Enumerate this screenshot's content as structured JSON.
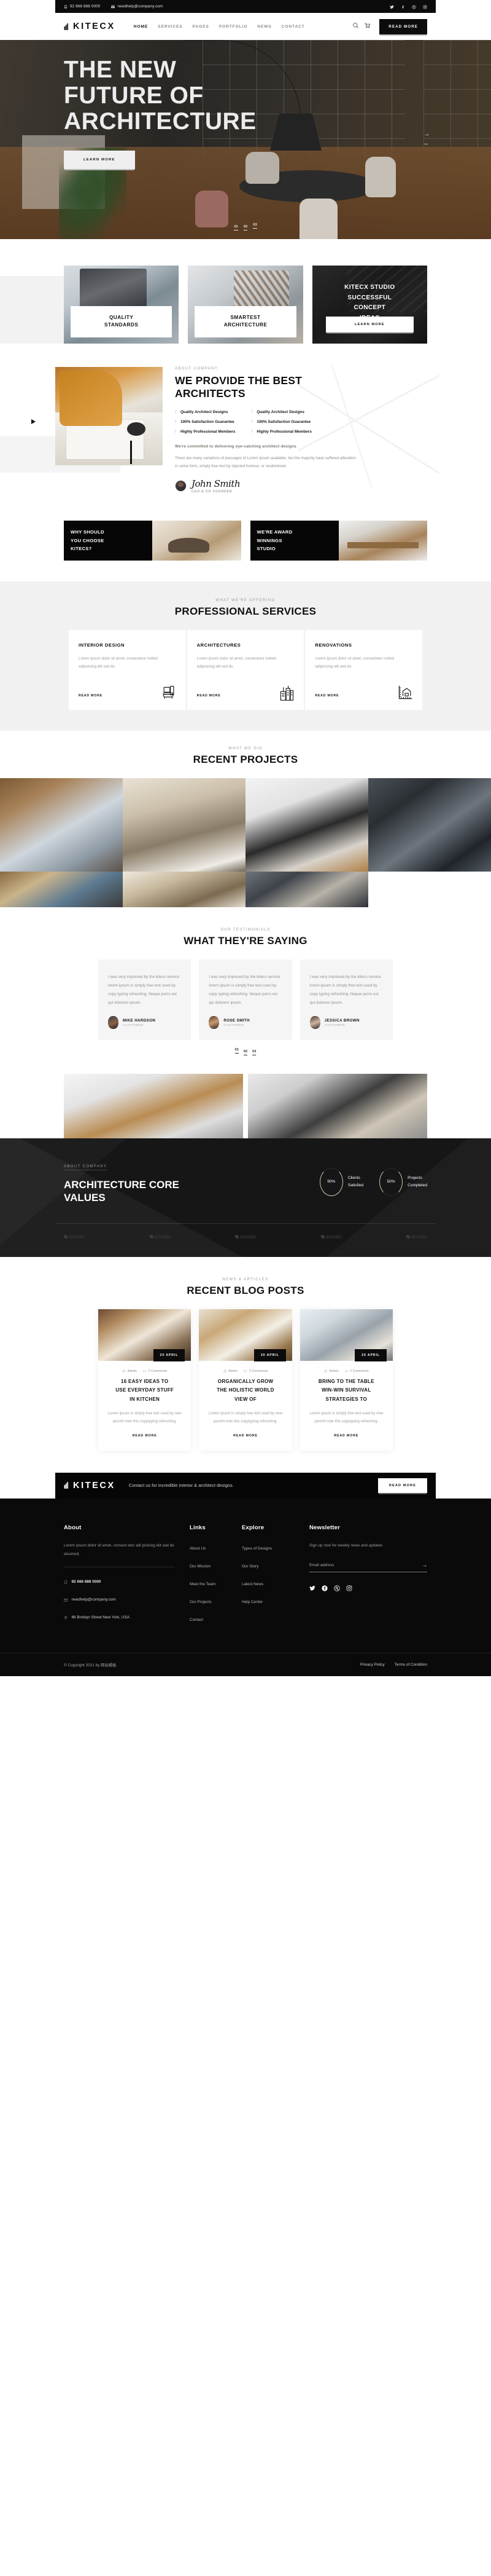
{
  "topbar": {
    "phone": "92 666 888 0000",
    "email": "needhelp@company.com",
    "socials": [
      "twitter-icon",
      "facebook-icon",
      "dribbble-icon",
      "instagram-icon"
    ]
  },
  "nav": {
    "logo": "KITECX",
    "items": [
      {
        "label": "HOME",
        "active": true
      },
      {
        "label": "SERVICES",
        "active": false
      },
      {
        "label": "PAGES",
        "active": false
      },
      {
        "label": "PORTFOLIO",
        "active": false
      },
      {
        "label": "NEWS",
        "active": false
      },
      {
        "label": "CONTACT",
        "active": false
      }
    ],
    "cta": "READ MORE"
  },
  "hero": {
    "title_line1": "THE NEW",
    "title_line2": "FUTURE OF",
    "title_line3": "ARCHITECTURE",
    "button": "LEARN MORE",
    "slides": [
      "01",
      "02",
      "03"
    ],
    "active_slide": "03"
  },
  "features": [
    {
      "label_line1": "QUALITY",
      "label_line2": "STANDARDS"
    },
    {
      "label_line1": "SMARTEST",
      "label_line2": "ARCHITECTURE"
    },
    {
      "title_line1": "KITECX STUDIO",
      "title_line2": "SUCCESSFUL",
      "title_line3": "CONCEPT",
      "title_line4": "IDEAS",
      "button": "LEARN MORE"
    }
  ],
  "about": {
    "eyebrow": "ABOUT COMPANY",
    "title_line1": "WE PROVIDE THE BEST",
    "title_line2": "ARCHITECTS",
    "checks_left": [
      "Quality Architect Designs",
      "100% Satisfaction Guarantee",
      "Highly Professional Members"
    ],
    "checks_right": [
      "Quality Architect Designs",
      "100% Satisfaction Guarantee",
      "Highly Professional Members"
    ],
    "lead": "We're committed to delivering eye-catching architect designs",
    "body": "There are many variations of passages of Lorem Ipsum available, but the majority have suffered alteration in some form, simply free text by injected humour, or randomised.",
    "signature": "John Smith",
    "role": "CEO & CO FOUNDER"
  },
  "twocards": [
    {
      "line1": "WHY SHOULD",
      "line2": "YOU CHOOSE",
      "line3": "KITECS?"
    },
    {
      "line1": "WE'RE AWARD",
      "line2": "WINNINGS",
      "line3": "STUDIO"
    }
  ],
  "services": {
    "eyebrow": "WHAT WE'RE OFFERING",
    "title": "PROFESSIONAL SERVICES",
    "cards": [
      {
        "title": "INTERIOR DESIGN",
        "text": "Lorem ipsum dolor sit amet, consectetur notted adipisicing elit sed do.",
        "link": "READ MORE",
        "icon": "sofa-icon"
      },
      {
        "title": "ARCHITECTURES",
        "text": "Lorem ipsum dolor sit amet, consectetur notted adipisicing elit sed do.",
        "link": "READ MORE",
        "icon": "buildings-icon"
      },
      {
        "title": "RENOVATIONS",
        "text": "Lorem ipsum dolor sit amet, consectetur notted adipisicing elit sed do.",
        "link": "READ MORE",
        "icon": "ruler-house-icon"
      }
    ]
  },
  "projects": {
    "eyebrow": "WHAT WE DID",
    "title": "RECENT PROJECTS"
  },
  "testimonials": {
    "eyebrow": "OUR TESTIMONIALS",
    "title": "WHAT THEY'RE SAYING",
    "quote": "I was very impresed by the kitecx service lorem ipsum is simply free text used by copy typing refreshing. Neque porro est qui dolorem ipsum.",
    "people": [
      {
        "name": "MIKE HARDSON",
        "role": "CUSTOMER"
      },
      {
        "name": "ROSE SMITH",
        "role": "CUSTOMER"
      },
      {
        "name": "JESSICA BROWN",
        "role": "CUSTOMER"
      }
    ],
    "slides": [
      "01",
      "02",
      "03"
    ],
    "active_slide": "01"
  },
  "core": {
    "eyebrow": "ABOUT COMPANY",
    "title_line1": "ARCHITECTURE CORE",
    "title_line2": "VALUES",
    "stats": [
      {
        "value": "90%",
        "label_line1": "Clients",
        "label_line2": "Satisfied"
      },
      {
        "value": "50%",
        "label_line1": "Projects",
        "label_line2": "Completed"
      }
    ],
    "brands": [
      "envato",
      "envato",
      "envato",
      "envato",
      "envato"
    ]
  },
  "blog": {
    "eyebrow": "NEWS & ARTICLES",
    "title": "RECENT BLOG POSTS",
    "posts": [
      {
        "date": "20 APRIL",
        "author": "Admin",
        "comments": "2 Comments",
        "title_line1": "16 EASY IDEAS TO",
        "title_line2": "USE EVERYDAY STUFF",
        "title_line3": "IN KITCHEN",
        "text": "Lorem ipsum is simply free text used by new pesnhl note this copytyping refreshing.",
        "link": "READ MORE"
      },
      {
        "date": "30 APRIL",
        "author": "Admin",
        "comments": "2 Comments",
        "title_line1": "ORGANICALLY GROW",
        "title_line2": "THE HOLISTIC WORLD",
        "title_line3": "VIEW OF",
        "text": "Lorem ipsum is simply free text used by new pesnhl note this copytyping refreshing.",
        "link": "READ MORE"
      },
      {
        "date": "20 APRIL",
        "author": "Admin",
        "comments": "2 Comments",
        "title_line1": "BRING TO THE TABLE",
        "title_line2": "WIN-WIN SURVIVAL",
        "title_line3": "STRATEGIES TO",
        "text": "Lorem ipsum is simply free text used by new pesnhl note this copytyping refreshing.",
        "link": "READ MORE"
      }
    ]
  },
  "cta": {
    "logo": "KITECX",
    "text": "Contact us for incredible interior & architect designs.",
    "button": "READ MORE"
  },
  "footer": {
    "about": {
      "heading": "About",
      "text": "Lorem ipsum dolor sit amet, consect etur adi pisicing elit sed do elusmod.",
      "phone": "92 666 888 0000",
      "email": "needhelp@company.com",
      "address": "66 Broklyn Street New York, USA"
    },
    "links": {
      "heading": "Links",
      "items": [
        "About Us",
        "Our Mission",
        "Meet the Team",
        "Our Projects",
        "Contact"
      ]
    },
    "explore": {
      "heading": "Explore",
      "items": [
        "Types of Designs",
        "Our Story",
        "Latest News",
        "Help Center"
      ]
    },
    "newsletter": {
      "heading": "Newsletter",
      "text": "Sign up now for weekly news and updates",
      "placeholder": "Email address",
      "socials": [
        "twitter-icon",
        "facebook-icon",
        "dribbble-icon",
        "instagram-icon"
      ]
    },
    "bottom": {
      "copyright": "© Copyright 2021 by 网站模板",
      "links": [
        "Privacy Policy",
        "Terms of Condition"
      ]
    }
  },
  "colors": {
    "dark": "#0c0c0c",
    "accent": "#cfc6ab",
    "muted": "#9a9a9a"
  }
}
